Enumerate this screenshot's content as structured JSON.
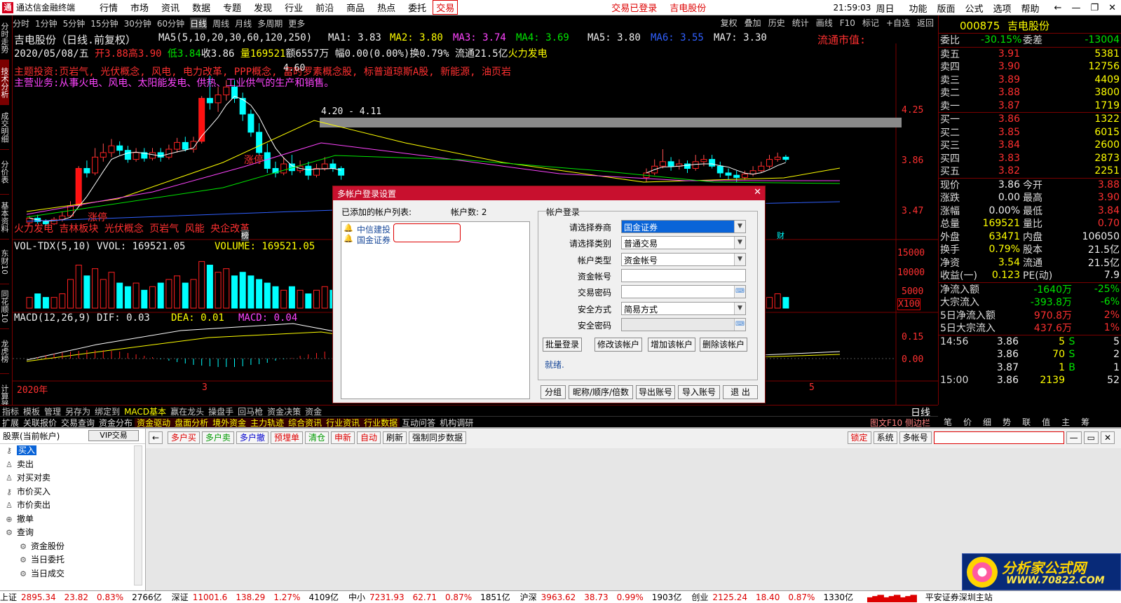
{
  "titlebar": {
    "app_name": "通达信金融终端",
    "menu": [
      "行情",
      "市场",
      "资讯",
      "数据",
      "专题",
      "发现",
      "行业",
      "前沿",
      "商品",
      "热点",
      "委托",
      "交易"
    ],
    "active_menu_index": 11,
    "status_login": "交易已登录",
    "status_stock": "吉电股份",
    "time": "21:59:03",
    "weekday": "周日",
    "right_menu": [
      "功能",
      "版面",
      "公式",
      "选项",
      "帮助"
    ]
  },
  "vtabs": [
    "分时走势",
    "技术分析",
    "成交明细",
    "分价表",
    "基本资料",
    "东财10",
    "同花顺10",
    "龙虎榜",
    "计算器"
  ],
  "vtabs_active": 1,
  "period_bar": [
    "分时",
    "1分钟",
    "5分钟",
    "15分钟",
    "30分钟",
    "60分钟",
    "日线",
    "周线",
    "月线",
    "多周期",
    "更多"
  ],
  "period_active": 6,
  "chart_tools": [
    "复权",
    "叠加",
    "历史",
    "统计",
    "画线",
    "F10",
    "标记",
    "+自选",
    "返回"
  ],
  "chart": {
    "stock_title": "吉电股份（日线.前复权）",
    "ma_header": {
      "label": "MA5(5,10,20,30,60,120,250)",
      "ma1": "MA1: 3.83",
      "ma2": "MA2: 3.80",
      "ma3": "MA3: 3.74",
      "ma4": "MA4: 3.69",
      "ma5": "MA5: 3.80",
      "ma6": "MA6: 3.55",
      "ma7": "MA7: 3.30"
    },
    "float_value_label": "流通市值:",
    "info_line": {
      "date": "2020/05/08/五",
      "open": "开3.88",
      "high": "高3.90",
      "low": "低3.84",
      "close": "收3.86",
      "vol": "量169521",
      "amount": "额6557万",
      "range": "幅0.00(0.00%)",
      "turnover": "换0.79%",
      "float": "流通21.5亿",
      "concept": "火力发电"
    },
    "theme_line": "主题投资:页岩气, 光伏概念, 风电, 电力改革, PPP概念, 富时罗素概念股, 标普道琼斯A股, 新能源, 油页岩",
    "business_line": "主营业务:从事火电、风电、太阳能发电、供热、工业供气的生产和销售。",
    "tags_line": "火力发电 吉林板块 光伏概念 页岩气 风能 央企改革",
    "price_peak": "4.60",
    "range_label": "4.20 - 4.11",
    "limit_up_1": "涨停",
    "limit_up_2": "涨停",
    "badge_bang": "榜",
    "badge_cai": "财",
    "price_axis": [
      "4.25",
      "3.86",
      "3.47"
    ],
    "vol_header": {
      "label": "VOL-TDX(5,10) VVOL: 169521.05",
      "volume": "VOLUME: 169521.05"
    },
    "vol_axis": [
      "15000",
      "10000",
      "5000",
      "X100"
    ],
    "macd_header": {
      "label": "MACD(12,26,9) DIF: 0.03",
      "dea": "DEA: 0.01",
      "macd": "MACD: 0.04"
    },
    "macd_axis": [
      "0.15",
      "0.00"
    ],
    "date_labels": [
      "2020年",
      "3",
      "5"
    ]
  },
  "chart_data": {
    "type": "candlestick",
    "price_range": [
      3.3,
      4.65
    ],
    "candles": [
      {
        "o": 3.3,
        "c": 3.34,
        "h": 3.36,
        "l": 3.28
      },
      {
        "o": 3.34,
        "c": 3.31,
        "h": 3.37,
        "l": 3.29
      },
      {
        "o": 3.31,
        "c": 3.29,
        "h": 3.33,
        "l": 3.27
      },
      {
        "o": 3.29,
        "c": 3.33,
        "h": 3.35,
        "l": 3.28
      },
      {
        "o": 3.33,
        "c": 3.36,
        "h": 3.4,
        "l": 3.31
      },
      {
        "o": 3.36,
        "c": 3.45,
        "h": 3.49,
        "l": 3.35
      },
      {
        "o": 3.45,
        "c": 3.78,
        "h": 3.8,
        "l": 3.44
      },
      {
        "o": 3.78,
        "c": 3.74,
        "h": 3.85,
        "l": 3.7
      },
      {
        "o": 3.74,
        "c": 3.88,
        "h": 3.96,
        "l": 3.72
      },
      {
        "o": 3.88,
        "c": 3.92,
        "h": 4.0,
        "l": 3.84
      },
      {
        "o": 3.92,
        "c": 3.98,
        "h": 4.04,
        "l": 3.88
      },
      {
        "o": 3.98,
        "c": 3.94,
        "h": 4.02,
        "l": 3.9
      },
      {
        "o": 3.94,
        "c": 3.86,
        "h": 3.98,
        "l": 3.83
      },
      {
        "o": 3.86,
        "c": 3.92,
        "h": 3.96,
        "l": 3.84
      },
      {
        "o": 3.92,
        "c": 3.87,
        "h": 3.96,
        "l": 3.84
      },
      {
        "o": 3.87,
        "c": 3.92,
        "h": 3.96,
        "l": 3.85
      },
      {
        "o": 3.92,
        "c": 3.88,
        "h": 3.96,
        "l": 3.84
      },
      {
        "o": 3.88,
        "c": 3.95,
        "h": 3.99,
        "l": 3.86
      },
      {
        "o": 3.95,
        "c": 4.01,
        "h": 4.05,
        "l": 3.92
      },
      {
        "o": 4.01,
        "c": 3.95,
        "h": 4.06,
        "l": 3.93
      },
      {
        "o": 3.95,
        "c": 4.02,
        "h": 4.06,
        "l": 3.92
      },
      {
        "o": 4.02,
        "c": 4.4,
        "h": 4.42,
        "l": 4.0
      },
      {
        "o": 4.4,
        "c": 4.36,
        "h": 4.6,
        "l": 4.3
      },
      {
        "o": 4.36,
        "c": 4.43,
        "h": 4.5,
        "l": 4.28
      },
      {
        "o": 4.43,
        "c": 4.5,
        "h": 4.56,
        "l": 4.38
      },
      {
        "o": 4.5,
        "c": 4.4,
        "h": 4.56,
        "l": 4.36
      },
      {
        "o": 4.4,
        "c": 4.26,
        "h": 4.45,
        "l": 4.2
      },
      {
        "o": 4.26,
        "c": 4.1,
        "h": 4.3,
        "l": 4.06
      },
      {
        "o": 4.1,
        "c": 3.92,
        "h": 4.18,
        "l": 3.9
      },
      {
        "o": 3.92,
        "c": 3.78,
        "h": 4.0,
        "l": 3.74
      },
      {
        "o": 3.78,
        "c": 3.74,
        "h": 3.84,
        "l": 3.7
      },
      {
        "o": 3.74,
        "c": 3.82,
        "h": 3.88,
        "l": 3.72
      },
      {
        "o": 3.82,
        "c": 3.76,
        "h": 3.9,
        "l": 3.72
      },
      {
        "o": 3.76,
        "c": 3.8,
        "h": 3.85,
        "l": 3.74
      },
      {
        "o": 3.8,
        "c": 3.72,
        "h": 3.84,
        "l": 3.68
      },
      {
        "o": 3.72,
        "c": 3.78,
        "h": 3.82,
        "l": 3.7
      },
      {
        "o": 3.78,
        "c": 3.82,
        "h": 3.88,
        "l": 3.76
      },
      {
        "o": 3.82,
        "c": 3.78,
        "h": 3.86,
        "l": 3.75
      },
      {
        "o": 3.78,
        "c": 3.72,
        "h": 3.8,
        "l": 3.68
      }
    ],
    "candles_right": [
      {
        "o": 3.7,
        "c": 3.74,
        "h": 3.78,
        "l": 3.66
      },
      {
        "o": 3.74,
        "c": 3.8,
        "h": 3.86,
        "l": 3.72
      },
      {
        "o": 3.8,
        "c": 3.84,
        "h": 3.95,
        "l": 3.78
      },
      {
        "o": 3.84,
        "c": 3.8,
        "h": 3.88,
        "l": 3.76
      },
      {
        "o": 3.8,
        "c": 3.82,
        "h": 3.86,
        "l": 3.77
      },
      {
        "o": 3.82,
        "c": 3.78,
        "h": 3.85,
        "l": 3.74
      },
      {
        "o": 3.78,
        "c": 3.84,
        "h": 3.9,
        "l": 3.76
      },
      {
        "o": 3.84,
        "c": 3.86,
        "h": 3.9,
        "l": 3.8
      },
      {
        "o": 3.86,
        "c": 3.8,
        "h": 3.9,
        "l": 3.78
      },
      {
        "o": 3.8,
        "c": 3.74,
        "h": 3.84,
        "l": 3.7
      },
      {
        "o": 3.74,
        "c": 3.72,
        "h": 3.78,
        "l": 3.68
      },
      {
        "o": 3.72,
        "c": 3.7,
        "h": 3.76,
        "l": 3.66
      },
      {
        "o": 3.7,
        "c": 3.73,
        "h": 3.76,
        "l": 3.68
      },
      {
        "o": 3.73,
        "c": 3.76,
        "h": 3.8,
        "l": 3.71
      },
      {
        "o": 3.76,
        "c": 3.8,
        "h": 3.84,
        "l": 3.74
      },
      {
        "o": 3.8,
        "c": 3.86,
        "h": 3.9,
        "l": 3.78
      },
      {
        "o": 3.86,
        "c": 3.88,
        "h": 3.92,
        "l": 3.84
      },
      {
        "o": 3.88,
        "c": 3.86,
        "h": 3.9,
        "l": 3.84
      }
    ],
    "volumes": [
      3,
      4,
      3,
      3,
      4,
      8,
      12,
      9,
      11,
      8,
      10,
      7,
      6,
      7,
      5,
      6,
      7,
      8,
      9,
      7,
      8,
      13,
      12,
      10,
      11,
      9,
      10,
      9,
      8,
      7,
      6,
      5,
      6,
      5,
      4,
      5,
      6,
      5,
      4
    ],
    "volumes_right": [
      3,
      4,
      6,
      5,
      4,
      3,
      4,
      5,
      4,
      3,
      3,
      3,
      3,
      3,
      4,
      3,
      4,
      3
    ],
    "volume_max": 16
  },
  "quote": {
    "code": "000875",
    "name": "吉电股份",
    "weibi": {
      "label": "委比",
      "value": "-30.15%",
      "label2": "委差",
      "value2": "-13004"
    },
    "sell": [
      {
        "label": "卖五",
        "price": "3.91",
        "vol": "5381"
      },
      {
        "label": "卖四",
        "price": "3.90",
        "vol": "12756"
      },
      {
        "label": "卖三",
        "price": "3.89",
        "vol": "4409"
      },
      {
        "label": "卖二",
        "price": "3.88",
        "vol": "3800"
      },
      {
        "label": "卖一",
        "price": "3.87",
        "vol": "1719"
      }
    ],
    "buy": [
      {
        "label": "买一",
        "price": "3.86",
        "vol": "1322"
      },
      {
        "label": "买二",
        "price": "3.85",
        "vol": "6015"
      },
      {
        "label": "买三",
        "price": "3.84",
        "vol": "2600"
      },
      {
        "label": "买四",
        "price": "3.83",
        "vol": "2873"
      },
      {
        "label": "买五",
        "price": "3.82",
        "vol": "2251"
      }
    ],
    "stats": [
      {
        "l": "现价",
        "v": "3.86",
        "l2": "今开",
        "v2": "3.88"
      },
      {
        "l": "涨跌",
        "v": "0.00",
        "l2": "最高",
        "v2": "3.90"
      },
      {
        "l": "涨幅",
        "v": "0.00%",
        "l2": "最低",
        "v2": "3.84"
      },
      {
        "l": "总量",
        "v": "169521",
        "l2": "量比",
        "v2": "0.70"
      },
      {
        "l": "外盘",
        "v": "63471",
        "l2": "内盘",
        "v2": "106050"
      },
      {
        "l": "换手",
        "v": "0.79%",
        "l2": "股本",
        "v2": "21.5亿"
      },
      {
        "l": "净资",
        "v": "3.54",
        "l2": "流通",
        "v2": "21.5亿"
      },
      {
        "l": "收益(一)",
        "v": "0.123",
        "l2": "PE(动)",
        "v2": "7.9"
      }
    ],
    "flows": [
      {
        "l": "净流入额",
        "v": "-1640万",
        "p": "-25%"
      },
      {
        "l": "大宗流入",
        "v": "-393.8万",
        "p": "-6%"
      },
      {
        "l": "5日净流入额",
        "v": "970.8万",
        "p": "2%"
      },
      {
        "l": "5日大宗流入",
        "v": "437.6万",
        "p": "1%"
      }
    ],
    "ticks": [
      {
        "t": "14:56",
        "p": "3.86",
        "v": "5",
        "s": "S",
        "n": "5"
      },
      {
        "t": "",
        "p": "3.86",
        "v": "70",
        "s": "S",
        "n": "2"
      },
      {
        "t": "",
        "p": "3.87",
        "v": "1",
        "s": "B",
        "n": "1"
      },
      {
        "t": "15:00",
        "p": "3.86",
        "v": "2139",
        "s": "",
        "n": "52"
      }
    ],
    "tabs": [
      "笔",
      "价",
      "细",
      "势",
      "联",
      "值",
      "主",
      "筹"
    ]
  },
  "bottom_tabs_1": [
    "指标",
    "模板",
    "管理",
    "另存为",
    "绑定到",
    "MACD基本",
    "赢在龙头",
    "操盘手",
    "回马枪",
    "资金决策",
    "资金"
  ],
  "bottom_tabs_1_right": "日线",
  "bottom_tabs_2": [
    "扩展",
    "关联报价",
    "交易查询",
    "资金分布",
    "资金驱动",
    "盘面分析",
    "境外资金",
    "主力轨迹",
    "综合资讯",
    "行业资讯",
    "行业数据",
    "互动问答",
    "机构调研"
  ],
  "bottom_tabs_2_right": "图文F10 侧边栏",
  "dialog": {
    "title": "多帐户登录设置",
    "list_label": "已添加的帐户列表:",
    "count_label": "帐户数: 2",
    "accounts": [
      "中信建投",
      "国金证券"
    ],
    "group_label": "帐户登录",
    "fields": [
      {
        "label": "请选择券商",
        "value": "国金证券",
        "type": "select",
        "selected": true
      },
      {
        "label": "请选择类别",
        "value": "普通交易",
        "type": "select"
      },
      {
        "label": "帐户类型",
        "value": "资金帐号",
        "type": "select"
      },
      {
        "label": "资金帐号",
        "value": "",
        "type": "input"
      },
      {
        "label": "交易密码",
        "value": "",
        "type": "password"
      },
      {
        "label": "安全方式",
        "value": "简易方式",
        "type": "select"
      },
      {
        "label": "安全密码",
        "value": "",
        "type": "disabled"
      }
    ],
    "buttons_row": [
      "批量登录",
      "修改该帐户",
      "增加该帐户",
      "删除该帐户"
    ],
    "status": "就绪.",
    "footer_buttons": [
      "分组",
      "昵称/顺序/倍数",
      "导出账号",
      "导入账号",
      "退 出"
    ]
  },
  "trade": {
    "tree_header": "股票(当前帐户)",
    "vip_button": "VIP交易",
    "tree": [
      {
        "label": "买入",
        "icon": "key-icon",
        "selected": true
      },
      {
        "label": "卖出",
        "icon": "user-icon"
      },
      {
        "label": "对买对卖",
        "icon": "user-icon"
      },
      {
        "label": "市价买入",
        "icon": "key-icon"
      },
      {
        "label": "市价卖出",
        "icon": "user-icon"
      },
      {
        "label": "撤单",
        "icon": "plus-icon"
      },
      {
        "label": "查询",
        "icon": "gear-icon"
      },
      {
        "label": "资金股份",
        "icon": "gear-icon",
        "sub": true
      },
      {
        "label": "当日委托",
        "icon": "gear-icon",
        "sub": true
      },
      {
        "label": "当日成交",
        "icon": "gear-icon",
        "sub": true
      }
    ],
    "toolbar": [
      {
        "label": "多户买",
        "style": "r"
      },
      {
        "label": "多户卖",
        "style": "g"
      },
      {
        "label": "多户撤",
        "style": "b"
      },
      {
        "label": "预埋单",
        "style": "r"
      },
      {
        "label": "清仓",
        "style": "g"
      },
      {
        "label": "申新",
        "style": "r"
      },
      {
        "label": "自动",
        "style": "r"
      },
      {
        "label": "刷新",
        "style": ""
      },
      {
        "label": "强制同步数据",
        "style": ""
      }
    ],
    "right_buttons": [
      "锁定",
      "系统",
      "多帐号"
    ]
  },
  "statusbar": [
    {
      "name": "上证",
      "v": "2895.34",
      "c": "23.82",
      "p": "0.83%",
      "a": "2766亿"
    },
    {
      "name": "深证",
      "v": "11001.6",
      "c": "138.29",
      "p": "1.27%",
      "a": "4109亿"
    },
    {
      "name": "中小",
      "v": "7231.93",
      "c": "62.71",
      "p": "0.87%",
      "a": "1851亿"
    },
    {
      "name": "沪深",
      "v": "3963.62",
      "c": "38.73",
      "p": "0.99%",
      "a": "1903亿"
    },
    {
      "name": "创业",
      "v": "2125.24",
      "c": "18.40",
      "p": "0.87%",
      "a": "1330亿"
    }
  ],
  "status_station": "平安证券深圳主站",
  "watermark": {
    "title": "分析家公式网",
    "url": "WWW.70822.COM"
  }
}
